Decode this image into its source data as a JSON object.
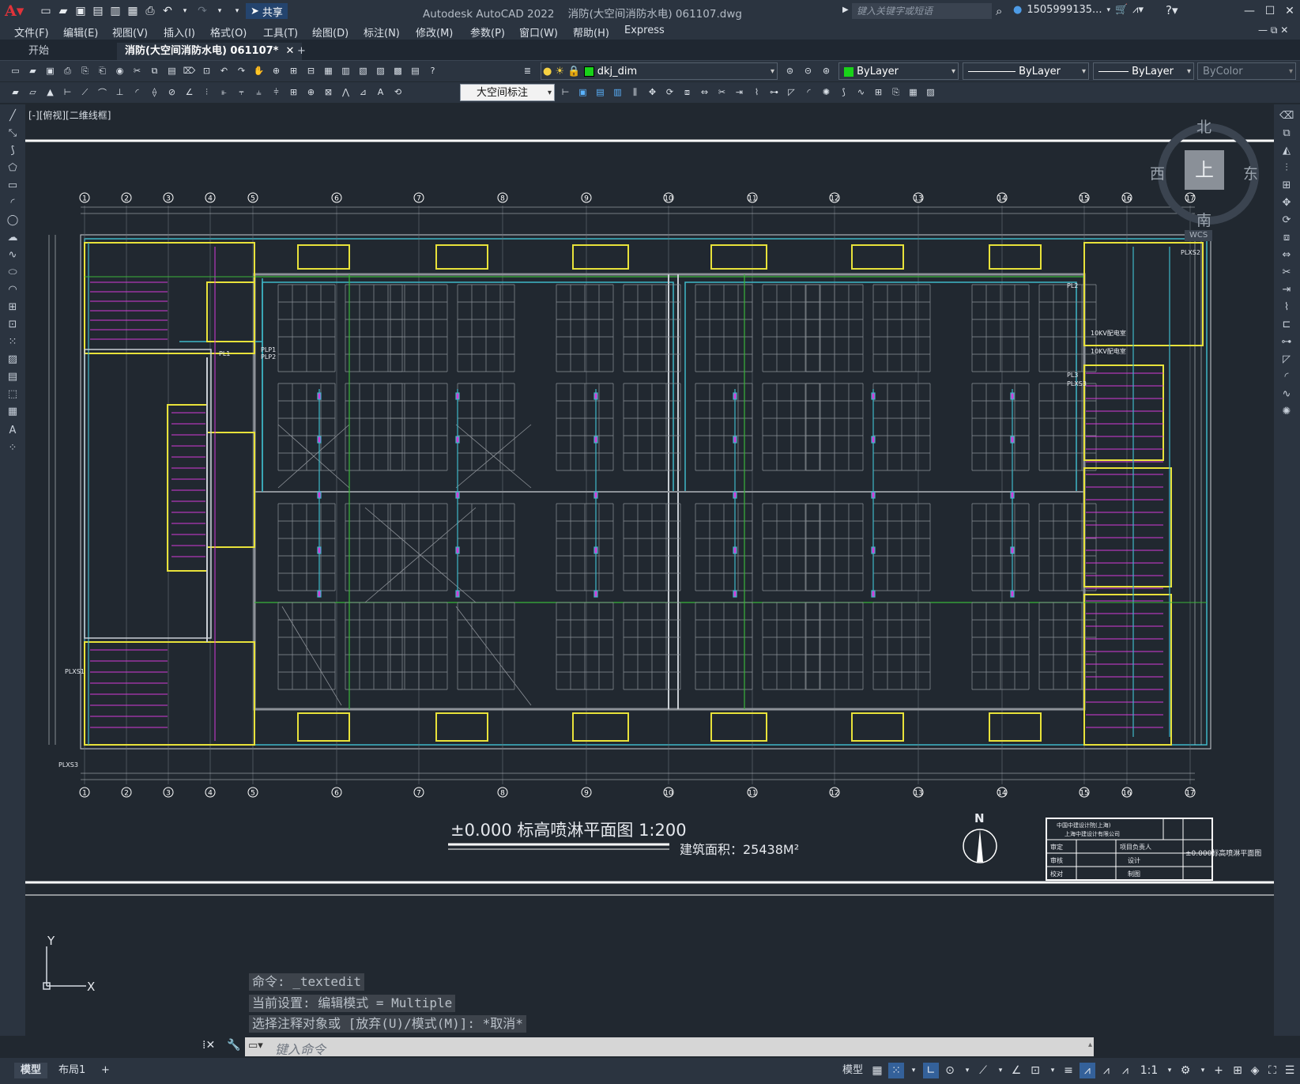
{
  "titlebar": {
    "app_title": "Autodesk AutoCAD 2022",
    "file_title": "消防(大空间消防水电) 061107.dwg",
    "share_label": "共享",
    "search_placeholder": "键入关键字或短语",
    "user_id": "1505999135..."
  },
  "menu": [
    "文件(F)",
    "编辑(E)",
    "视图(V)",
    "插入(I)",
    "格式(O)",
    "工具(T)",
    "绘图(D)",
    "标注(N)",
    "修改(M)",
    "参数(P)",
    "窗口(W)",
    "帮助(H)",
    "Express"
  ],
  "tabs": {
    "start": "开始",
    "active": "消防(大空间消防水电) 061107*",
    "plus": "+"
  },
  "properties": {
    "layer": "dkj_dim",
    "color": "ByLayer",
    "linetype": "ByLayer",
    "lineweight": "ByLayer",
    "plotstyle": "ByColor",
    "dimstyle": "大空间标注"
  },
  "viewport": {
    "label": "[-][俯视][二维线框]"
  },
  "viewcube": {
    "north": "北",
    "south": "南",
    "east": "东",
    "west": "西",
    "top": "上",
    "wcs": "WCS"
  },
  "drawing": {
    "title": "±0.000 标高喷淋平面图 1:200",
    "area_label": "建筑面积：25438M²",
    "north_label": "N",
    "grid_labels": [
      "1",
      "2",
      "3",
      "4",
      "5",
      "6",
      "7",
      "8",
      "9",
      "10",
      "11",
      "12",
      "13",
      "14",
      "15",
      "16",
      "17"
    ],
    "titleblock": {
      "company_1": "中国中建设计院(上海)",
      "company_2": "上海中建设计有限公司",
      "rows": [
        "审定",
        "审核",
        "校对"
      ],
      "cols": [
        "项目负责人",
        "设计",
        "制图"
      ],
      "sheet_title": "±0.000标高喷淋平面图"
    },
    "side_labels": [
      "10KV配电室",
      "10KV配电室",
      "PL2",
      "PL3",
      "PLXS3",
      "PLXS2",
      "PL1",
      "PLP1",
      "PLP2",
      "PLXS1",
      "PLXS3"
    ]
  },
  "command": {
    "history": [
      "命令: _textedit",
      "当前设置: 编辑模式 = Multiple",
      "选择注释对象或 [放弃(U)/模式(M)]: *取消*"
    ],
    "placeholder": "键入命令"
  },
  "ucs": {
    "x": "X",
    "y": "Y"
  },
  "status": {
    "tab_model": "模型",
    "tab_layout": "布局1",
    "tab_add": "+",
    "model_label": "模型",
    "scale": "1:1"
  },
  "colors": {
    "canvas": "#212830",
    "grid": "#8d9298",
    "yellow": "#e8e23a",
    "cyan": "#3fb7c8",
    "magenta": "#d43ad9",
    "green": "#3ab53a"
  }
}
